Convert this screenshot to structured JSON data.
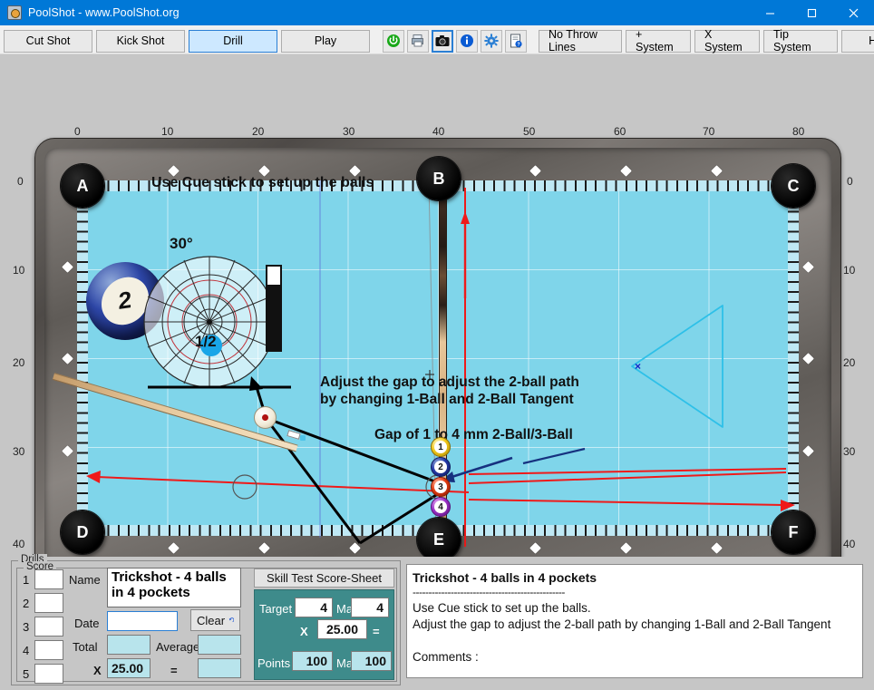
{
  "window": {
    "title": "PoolShot - www.PoolShot.org",
    "icon": "poolshot-logo-icon",
    "minimize": "—",
    "maximize": "▢",
    "close": "✕"
  },
  "toolbar": {
    "modes": [
      {
        "label": "Cut Shot",
        "active": false
      },
      {
        "label": "Kick Shot",
        "active": false
      },
      {
        "label": "Drill",
        "active": true
      },
      {
        "label": "Play",
        "active": false
      }
    ],
    "icons": [
      {
        "name": "power-icon",
        "glyph": "⏻",
        "color": "#1aa11a",
        "selected": false
      },
      {
        "name": "print-icon",
        "glyph": "🖶",
        "color": "#4a5a6a",
        "selected": false
      },
      {
        "name": "camera-icon",
        "glyph": "▣",
        "color": "#1a1a1a",
        "selected": true
      },
      {
        "name": "info-icon",
        "glyph": "i",
        "color": "#0a5bd3",
        "selected": false
      },
      {
        "name": "settings-gear-icon",
        "glyph": "✷",
        "color": "#2a7fd4",
        "selected": false
      },
      {
        "name": "help-document-icon",
        "glyph": "▤",
        "color": "#4a5a6a",
        "selected": false
      }
    ],
    "systems": [
      {
        "label": "No Throw Lines"
      },
      {
        "label": "+ System"
      },
      {
        "label": "X System"
      },
      {
        "label": "Tip System"
      },
      {
        "label": "Help"
      }
    ]
  },
  "table": {
    "top_ruler": [
      "0",
      "10",
      "20",
      "30",
      "40",
      "50",
      "60",
      "70",
      "80"
    ],
    "left_ruler": [
      "0",
      "10",
      "20",
      "30",
      "40"
    ],
    "right_ruler": [
      "0",
      "10",
      "20",
      "30",
      "40"
    ],
    "pockets": [
      "A",
      "B",
      "C",
      "D",
      "E",
      "F"
    ],
    "annotations": {
      "setup": "Use Cue stick to set up the balls",
      "angle": "30°",
      "fraction": "1/2",
      "adjust_line1": "Adjust the gap to adjust the 2-ball path",
      "adjust_line2": "by changing 1-Ball and 2-Ball Tangent",
      "gap": "Gap of 1 to 4 mm 2-Ball/3-Ball"
    },
    "balls": [
      {
        "num": "1",
        "color": "#f2c818"
      },
      {
        "num": "2",
        "color": "#2438a8"
      },
      {
        "num": "3",
        "color": "#e23a10"
      },
      {
        "num": "4",
        "color": "#9b30c8"
      }
    ],
    "object_ball": {
      "num": "2",
      "color": "#2438a8"
    },
    "cue_ball_marker": "cue-ball",
    "rack_marker": "×",
    "colors": {
      "cloth": "#7fd5ea",
      "rail": "#6a6561",
      "pocket": "#000000",
      "aim_line_red": "#ef1a1a",
      "tangent_black": "#000000",
      "rack_cyan": "#2ec0e8",
      "arrow_navy": "#16317f"
    }
  },
  "bottom": {
    "drills_group": "Drills",
    "score_group": "Score",
    "rows": [
      "1",
      "2",
      "3",
      "4",
      "5"
    ],
    "row_values": [
      "",
      "",
      "",
      "",
      ""
    ],
    "name_label": "Name",
    "name_value": "Trickshot - 4 balls in 4 pockets",
    "date_label": "Date",
    "date_value": "",
    "clear_label": "Clear",
    "clear_icon": "undo-arrow-icon",
    "total_label": "Total",
    "total_value": "",
    "average_label": "Average",
    "average_value": "",
    "multiply_label": "X",
    "multiplier_value": "25.00",
    "equals_label": "=",
    "result_value": "",
    "skill_header": "Skill Test Score-Sheet",
    "target_label": "Target",
    "target_value": "4",
    "target_max_label": "Max",
    "target_max_value": "4",
    "teal_multiply_label": "X",
    "teal_multiplier_value": "25.00",
    "teal_equals_label": "=",
    "points_label": "Points",
    "points_value": "100",
    "points_max_label": "Max",
    "points_max_value": "100",
    "description": {
      "title": "Trickshot - 4 balls in 4 pockets",
      "rule": "------------------------------------------------",
      "line1": "Use Cue stick to set up the balls.",
      "line2": "Adjust the gap to adjust the 2-ball path by changing 1-Ball and 2-Ball Tangent",
      "comments_label": "Comments :"
    }
  }
}
